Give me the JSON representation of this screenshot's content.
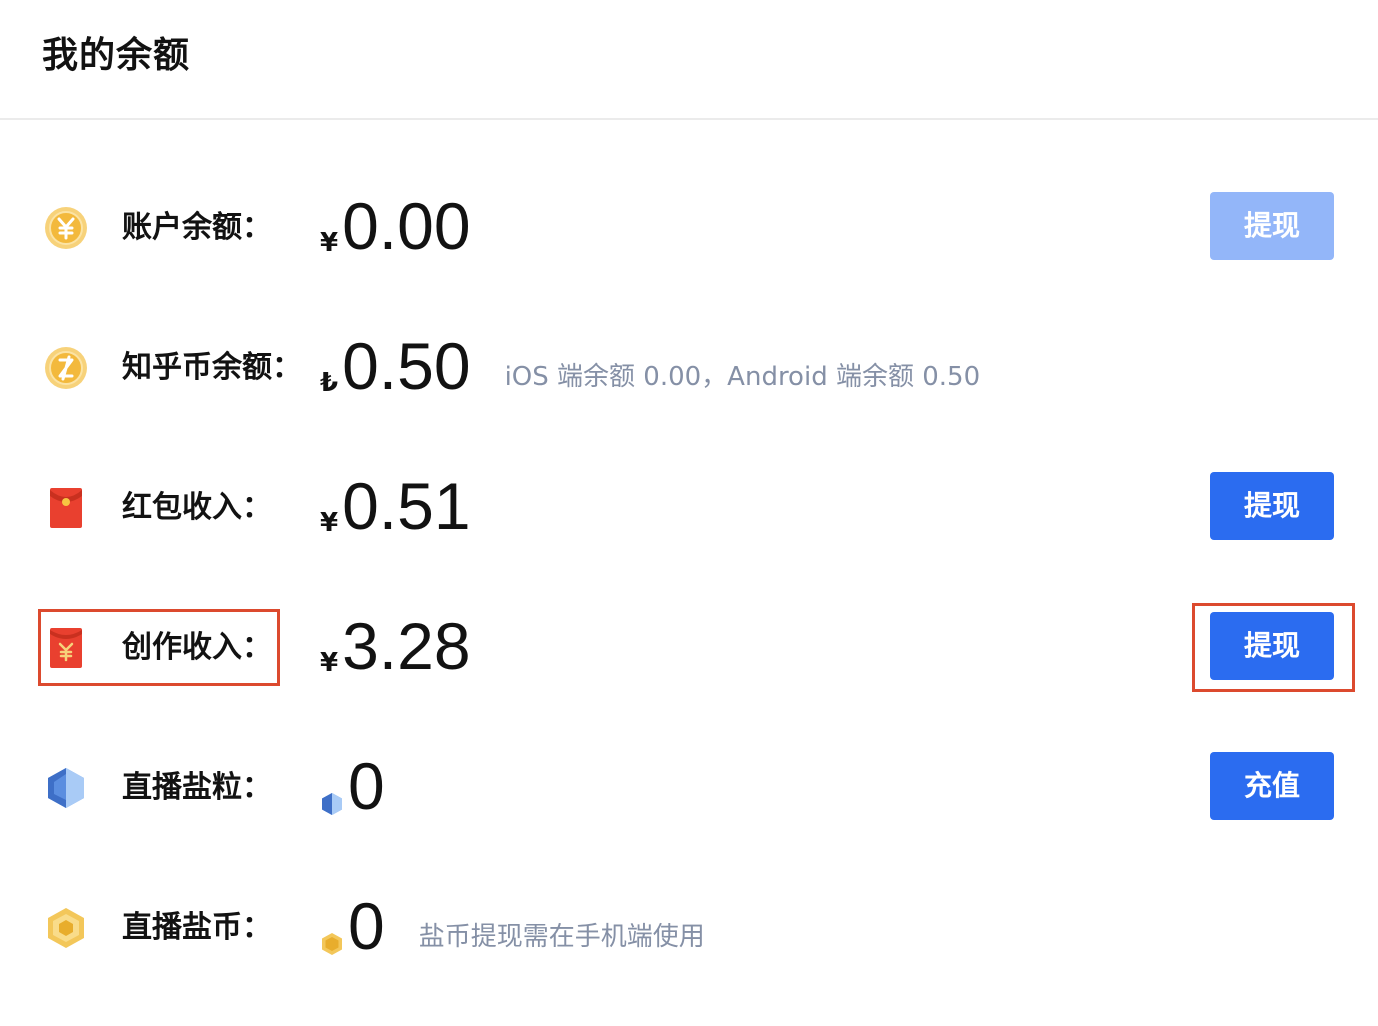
{
  "header": {
    "title": "我的余额"
  },
  "rows": [
    {
      "label": "账户余额：",
      "unit": "¥",
      "value": "0.00",
      "note": "",
      "button": "提现",
      "button_disabled": true,
      "icon": "yuan-coin-icon"
    },
    {
      "label": "知乎币余额：",
      "unit": "₺",
      "value": "0.50",
      "note": "iOS 端余额 0.00，Android 端余额 0.50",
      "button": "",
      "icon": "zhihu-coin-icon"
    },
    {
      "label": "红包收入：",
      "unit": "¥",
      "value": "0.51",
      "note": "",
      "button": "提现",
      "button_disabled": false,
      "icon": "red-envelope-icon"
    },
    {
      "label": "创作收入：",
      "unit": "¥",
      "value": "3.28",
      "note": "",
      "button": "提现",
      "button_disabled": false,
      "icon": "creation-envelope-icon"
    },
    {
      "label": "直播盐粒：",
      "unit": "",
      "value": "0",
      "note": "",
      "button": "充值",
      "button_disabled": false,
      "icon": "salt-crystal-icon"
    },
    {
      "label": "直播盐币：",
      "unit": "",
      "value": "0",
      "note": "盐币提现需在手机端使用",
      "button": "",
      "icon": "salt-coin-icon"
    }
  ],
  "colors": {
    "primary_button": "#2b6cf0",
    "disabled_button": "#93b6f9",
    "highlight_border": "#dc4a2e",
    "note_text": "#8590a6"
  }
}
